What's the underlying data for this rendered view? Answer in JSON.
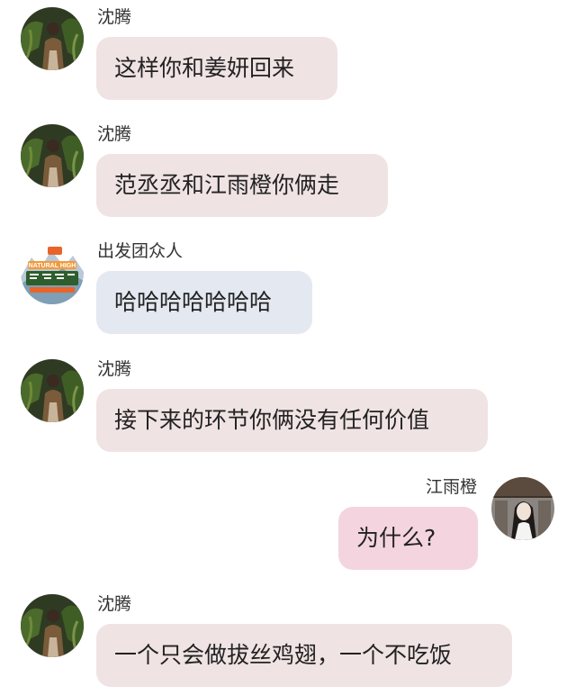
{
  "colors": {
    "bubble_shen": "#f0e3e4",
    "bubble_group": "#e4e8f1",
    "bubble_self": "#f4d5df"
  },
  "messages": [
    {
      "sender": "沈腾",
      "text": "这样你和姜妍回来",
      "side": "left",
      "avatar_icon": "shen-teng-avatar-icon"
    },
    {
      "sender": "沈腾",
      "text": "范丞丞和江雨橙你俩走",
      "side": "left",
      "avatar_icon": "shen-teng-avatar-icon"
    },
    {
      "sender": "出发团众人",
      "text": "哈哈哈哈哈哈哈",
      "side": "left",
      "avatar_icon": "group-logo-avatar-icon",
      "logo_text": "NATURAL HIGH"
    },
    {
      "sender": "沈腾",
      "text": "接下来的环节你俩没有任何价值",
      "side": "left",
      "avatar_icon": "shen-teng-avatar-icon"
    },
    {
      "sender": "江雨橙",
      "text": "为什么?",
      "side": "right",
      "avatar_icon": "jiang-yucheng-avatar-icon"
    },
    {
      "sender": "沈腾",
      "text": "一个只会做拔丝鸡翅，一个不吃饭",
      "side": "left",
      "avatar_icon": "shen-teng-avatar-icon"
    }
  ]
}
